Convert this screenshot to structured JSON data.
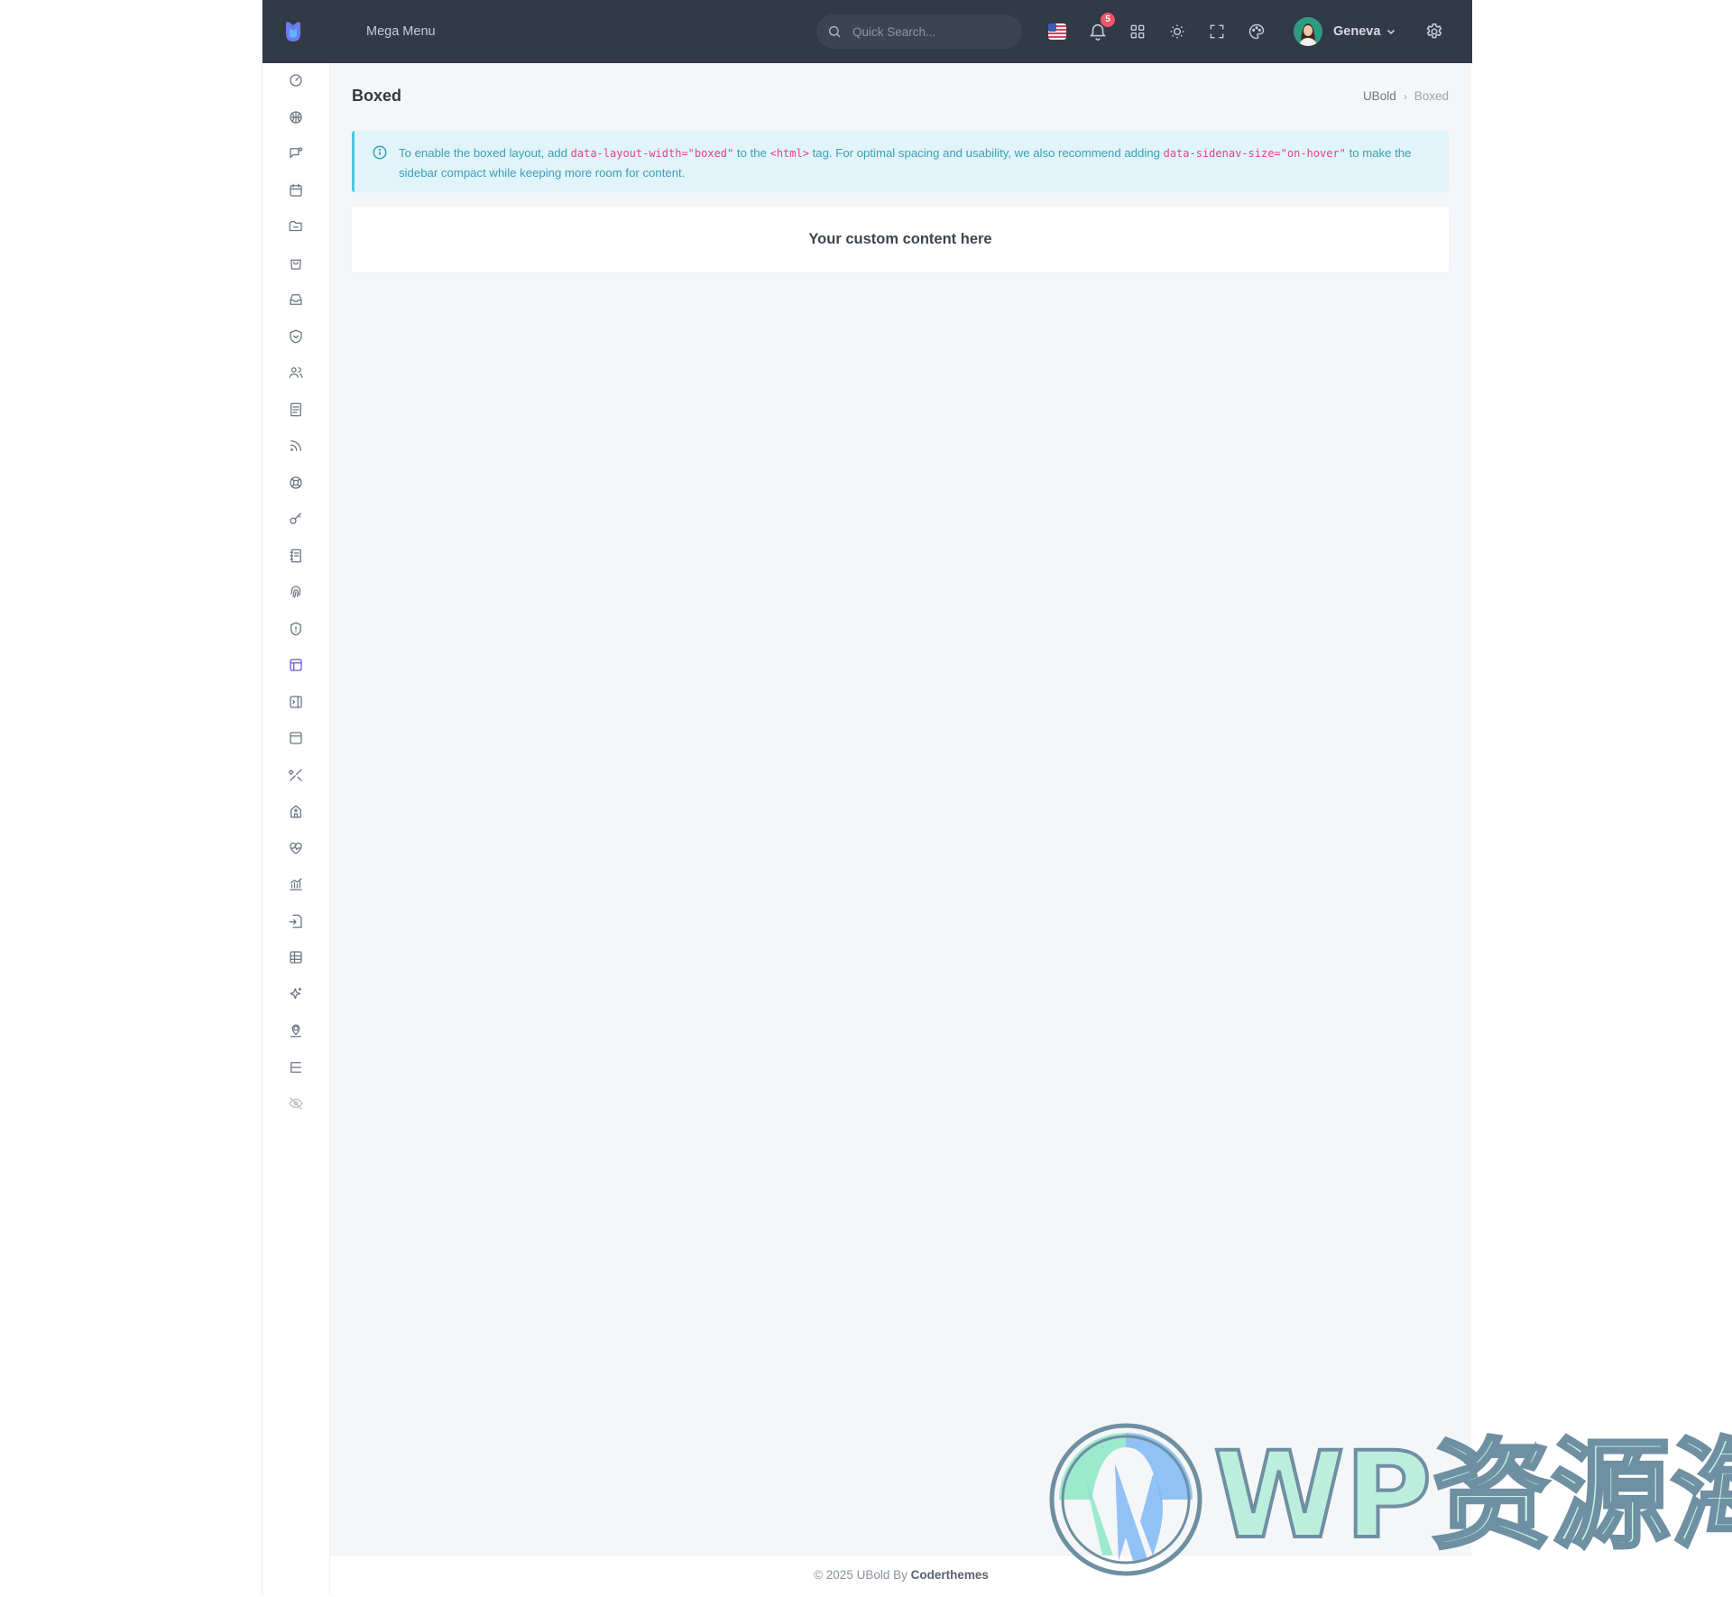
{
  "header": {
    "mega_menu": "Mega Menu",
    "search_placeholder": "Quick Search...",
    "notification_count": "5",
    "user_name": "Geneva"
  },
  "sidebar": {
    "icons": [
      "gauge-icon",
      "basketball-icon",
      "message-icon",
      "calendar-icon",
      "folder-icon",
      "shopping-bag-icon",
      "inbox-icon",
      "shield-heart-icon",
      "users-icon",
      "file-text-icon",
      "rss-icon",
      "lifebuoy-icon",
      "key-icon",
      "notebook-icon",
      "fingerprint-icon",
      "shield-exclamation-icon",
      "layout-boxed-icon",
      "sidebar-right-icon",
      "layout-navbar-icon",
      "tools-icon",
      "building-icon",
      "activity-heart-icon",
      "chart-line-icon",
      "file-import-icon",
      "table-icon",
      "sparkles-icon",
      "map-pin-icon",
      "list-tree-icon",
      "eye-off-icon"
    ],
    "active_index": 16,
    "active_color": "#6658dd"
  },
  "page": {
    "title": "Boxed",
    "breadcrumb_root": "UBold",
    "breadcrumb_separator": "›",
    "breadcrumb_current": "Boxed"
  },
  "alert": {
    "part1": "To enable the boxed layout, add ",
    "code1": "data-layout-width=\"boxed\"",
    "part2": " to the ",
    "code2": "<html>",
    "part3": " tag. For optimal spacing and usability, we also recommend adding ",
    "code3": "data-sidenav-size=\"on-hover\"",
    "part4": " to make the sidebar compact while keeping more room for content."
  },
  "card": {
    "text": "Your custom content here"
  },
  "footer": {
    "prefix": "© 2025 UBold By ",
    "brand": "Coderthemes"
  },
  "watermark": {
    "latin": "WP",
    "cjk": "资源海"
  },
  "colors": {
    "topbar": "#313a46",
    "content_bg": "#f5f6f8",
    "alert_bg": "#e1f4f9",
    "alert_text": "#3b9fb6",
    "code": "#e83e8c",
    "badge": "#f1556c"
  }
}
